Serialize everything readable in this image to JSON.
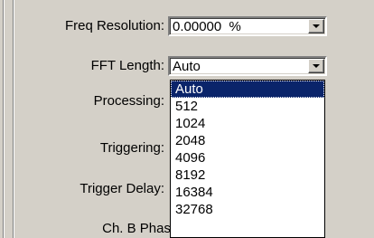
{
  "form": {
    "freq_resolution": {
      "label": "Freq Resolution:",
      "value": "0.00000  %"
    },
    "fft_length": {
      "label": "FFT Length:",
      "value": "Auto"
    },
    "processing": {
      "label": "Processing:"
    },
    "triggering": {
      "label": "Triggering:"
    },
    "trigger_delay": {
      "label": "Trigger Delay:"
    },
    "ch_b_phase": {
      "label": "Ch. B Phas"
    }
  },
  "dropdown": {
    "selected": "Auto",
    "options": [
      "Auto",
      "512",
      "1024",
      "2048",
      "4096",
      "8192",
      "16384",
      "32768"
    ]
  },
  "colors": {
    "selection": "#0a246a",
    "face": "#d4d0c8"
  }
}
